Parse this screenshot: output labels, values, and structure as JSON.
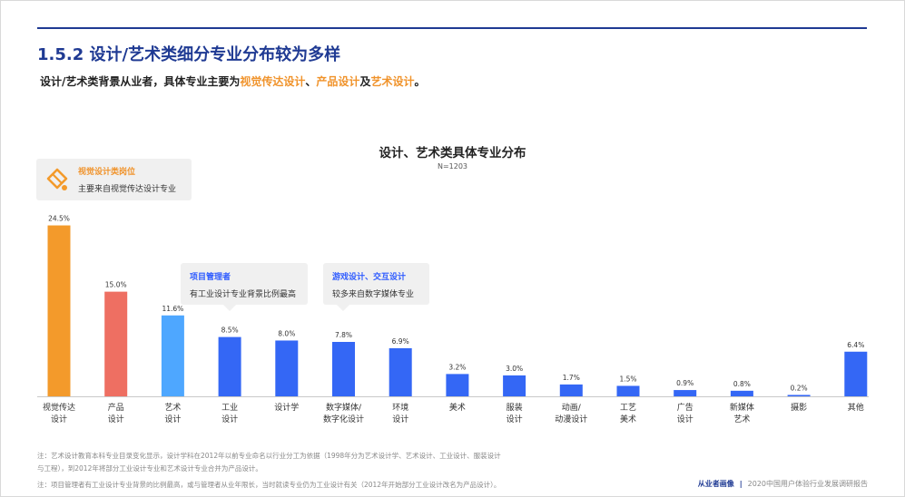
{
  "header": {
    "section_title": "1.5.2 设计/艺术类细分专业分布较为多样",
    "subtitle_parts": [
      "设计/艺术类背景从业者，具体专业主要为",
      "视觉传达设计",
      "、",
      "产品设计",
      "及",
      "艺术设计",
      "。"
    ]
  },
  "colors": {
    "orange": "#f39a2b",
    "salmon": "#ee6f62",
    "light_blue": "#4ea7ff",
    "blue": "#3467f5",
    "title_blue": "#1f3a93"
  },
  "chart_data": {
    "type": "bar",
    "title": "设计、艺术类具体专业分布",
    "subtitle": "N=1203",
    "unit": "%",
    "ylim": [
      0,
      26
    ],
    "grid": false,
    "legend": "none",
    "categories": [
      [
        "视觉传达",
        "设计"
      ],
      [
        "产品",
        "设计"
      ],
      [
        "艺术",
        "设计"
      ],
      [
        "工业",
        "设计"
      ],
      [
        "设计学"
      ],
      [
        "数字媒体/",
        "数字化设计"
      ],
      [
        "环境",
        "设计"
      ],
      [
        "美术"
      ],
      [
        "服装",
        "设计"
      ],
      [
        "动画/",
        "动漫设计"
      ],
      [
        "工艺",
        "美术"
      ],
      [
        "广告",
        "设计"
      ],
      [
        "新媒体",
        "艺术"
      ],
      [
        "摄影"
      ],
      [
        "其他"
      ]
    ],
    "values": [
      24.5,
      15.0,
      11.6,
      8.5,
      8.0,
      7.8,
      6.9,
      3.2,
      3.0,
      1.7,
      1.5,
      0.9,
      0.8,
      0.2,
      6.4
    ],
    "labels": [
      "24.5%",
      "15.0%",
      "11.6%",
      "8.5%",
      "8.0%",
      "7.8%",
      "6.9%",
      "3.2%",
      "3.0%",
      "1.7%",
      "1.5%",
      "0.9%",
      "0.8%",
      "0.2%",
      "6.4%"
    ],
    "bar_colors": [
      "#f39a2b",
      "#ee6f62",
      "#4ea7ff",
      "#3467f5",
      "#3467f5",
      "#3467f5",
      "#3467f5",
      "#3467f5",
      "#3467f5",
      "#3467f5",
      "#3467f5",
      "#3467f5",
      "#3467f5",
      "#3467f5",
      "#3467f5"
    ]
  },
  "callouts": [
    {
      "title": "视觉设计类岗位",
      "text": "主要来自视觉传达设计专业",
      "icon": "design-pen-icon"
    },
    {
      "title": "项目管理者",
      "text": "有工业设计专业背景比例最高"
    },
    {
      "title": "游戏设计、交互设计",
      "text": "较多来自数字媒体专业"
    }
  ],
  "notes": [
    "注：艺术设计教育本科专业目录变化显示，设计学科在2012年以前专业命名以行业分工为依据（1998年分为艺术设计学、艺术设计、工业设计、服装设计",
    "与工程），到2012年将部分工业设计专业和艺术设计专业合并为产品设计。",
    "注：项目管理者有工业设计专业背景的比例最高，或与管理者从业年限长，当时就读专业仍为工业设计有关（2012年开始部分工业设计改名为产品设计）。"
  ],
  "footer": {
    "section": "从业者画像",
    "separator": "|",
    "report": "2020中国用户体验行业发展调研报告"
  }
}
